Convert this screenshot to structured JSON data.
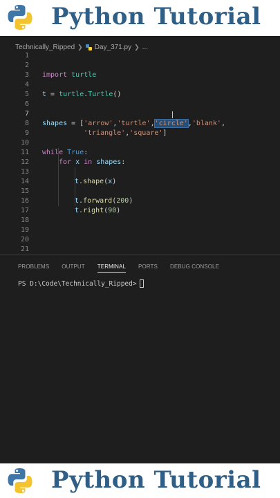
{
  "banner": {
    "title": "Python Tutorial",
    "logo_icon": "python-logo-icon",
    "colors": {
      "title": "#2f5f86",
      "logo_blue": "#3e76a8",
      "logo_yellow": "#f4c430"
    }
  },
  "editor": {
    "breadcrumb": {
      "folder": "Technically_Ripped",
      "file": "Day_371.py",
      "ellipsis": "..."
    },
    "colors": {
      "background": "#1e1e1e",
      "keyword": "#c586c0",
      "function": "#dcdcaa",
      "variable": "#9cdcfe",
      "class": "#4ec9b0",
      "string": "#ce9178",
      "number": "#b5cea8",
      "selection": "#264f78"
    },
    "active_line": "7",
    "lines": {
      "l2": {
        "kw1": "import",
        "mod": "turtle"
      },
      "l4": {
        "var": "t",
        "eq": " = ",
        "mod": "turtle",
        "dot": ".",
        "cls": "Turtle",
        "paren": "()"
      },
      "l7": {
        "var": "shapes",
        "eq": " = [",
        "s1": "'arrow'",
        "c1": ",",
        "s2": "'turtle'",
        "c2": ",",
        "s3": "'circle'",
        "c3": ",",
        "s4": "'blank'",
        "c4": ","
      },
      "l8": {
        "s5": "'triangle'",
        "c5": ",",
        "s6": "'square'",
        "close": "]"
      },
      "l10": {
        "kw": "while",
        "const": " True",
        "colon": ":"
      },
      "l11": {
        "kw1": "for",
        "var1": " x ",
        "kw2": "in",
        "var2": " shapes",
        "colon": ":"
      },
      "l13": {
        "obj": "t",
        "dot": ".",
        "fn": "shape",
        "open": "(",
        "arg": "x",
        "close": ")"
      },
      "l15": {
        "obj": "t",
        "dot": ".",
        "fn": "forward",
        "open": "(",
        "num": "200",
        "close": ")"
      },
      "l16": {
        "obj": "t",
        "dot": ".",
        "fn": "right",
        "open": "(",
        "num": "90",
        "close": ")"
      }
    },
    "line_numbers": [
      "1",
      "2",
      "3",
      "4",
      "5",
      "6",
      "7",
      "8",
      "9",
      "10",
      "11",
      "12",
      "13",
      "14",
      "15",
      "16",
      "17",
      "18",
      "19",
      "20",
      "21"
    ]
  },
  "panel": {
    "tabs": [
      "PROBLEMS",
      "OUTPUT",
      "TERMINAL",
      "PORTS",
      "DEBUG CONSOLE"
    ],
    "active_tab": "TERMINAL",
    "terminal_prompt": "PS D:\\Code\\Technically_Ripped>"
  }
}
